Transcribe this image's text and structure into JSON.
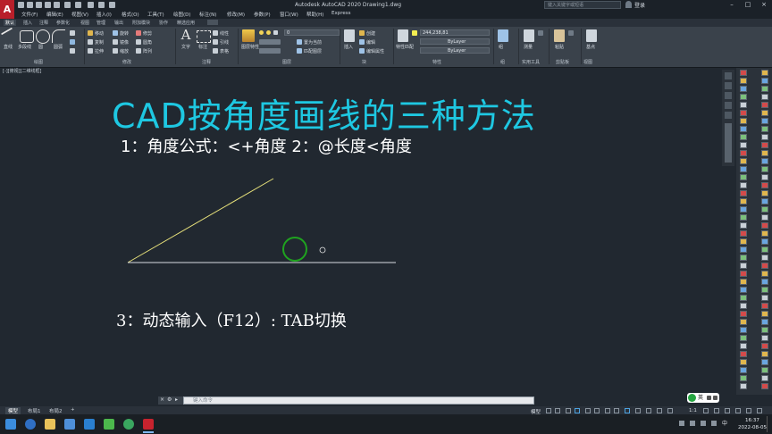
{
  "titlebar": {
    "title": "Autodesk AutoCAD 2020    Drawing1.dwg",
    "search_placeholder": "键入关键字或短语",
    "user": "登录"
  },
  "menubar": [
    "文件(F)",
    "编辑(E)",
    "视图(V)",
    "插入(I)",
    "格式(O)",
    "工具(T)",
    "绘图(D)",
    "标注(N)",
    "修改(M)",
    "参数(P)",
    "窗口(W)",
    "帮助(H)",
    "Express"
  ],
  "ribbon_tabs": [
    "默认",
    "插入",
    "注释",
    "参数化",
    "视图",
    "管理",
    "输出",
    "附加模块",
    "协作",
    "精选应用"
  ],
  "ribbon": {
    "draw_panel": "绘图",
    "modify_panel": "修改",
    "annotation_panel": "注释",
    "layers_panel": "图层",
    "block_panel": "块",
    "properties_panel": "特性",
    "groups_panel": "组",
    "utilities_panel": "实用工具",
    "clipboard_panel": "剪贴板",
    "view_panel": "视图",
    "line_label": "直线",
    "polyline_label": "多段线",
    "circle_label": "圆",
    "arc_label": "圆弧",
    "move_label": "移动",
    "rotate_label": "旋转",
    "trim_label": "修剪",
    "copy_label": "复制",
    "mirror_label": "镜像",
    "fillet_label": "圆角",
    "stretch_label": "拉伸",
    "scale_label": "缩放",
    "array_label": "阵列",
    "text_label": "文字",
    "dim_label": "标注",
    "linear_label": "线性",
    "leader_label": "引线",
    "table_label": "表格",
    "layer_prop_label": "图层特性",
    "layer_value": "0",
    "make_current_label": "置为当前",
    "match_layer_label": "匹配图层",
    "insert_label": "插入",
    "create_label": "创建",
    "edit_label": "编辑",
    "edit_attr_label": "编辑属性",
    "match_prop_label": "特性匹配",
    "color_value": "244,238,81",
    "linetype_value": "ByLayer",
    "lineweight_value": "ByLayer",
    "group_label": "组",
    "measure_label": "测量",
    "paste_label": "粘贴",
    "base_label": "基点"
  },
  "viewport_label": "[-][俯视][二维线框]",
  "drawing": {
    "title": "CAD按角度画线的三种方法",
    "line1": "1：角度公式：<+角度   2：@长度<角度",
    "line3": "3：动态输入（F12）: TAB切换",
    "angle_line_color": "#e6e07a",
    "base_line_color": "#d9dde2",
    "circle_color": "#1fa31f"
  },
  "command_line": {
    "placeholder": "键入命令"
  },
  "layout_tabs": [
    "模型",
    "布局1",
    "布局2",
    "+"
  ],
  "status": {
    "model": "模型",
    "scale": "1:1"
  },
  "ime": "英",
  "clock": {
    "time": "16:37",
    "date": "2022-08-05"
  }
}
